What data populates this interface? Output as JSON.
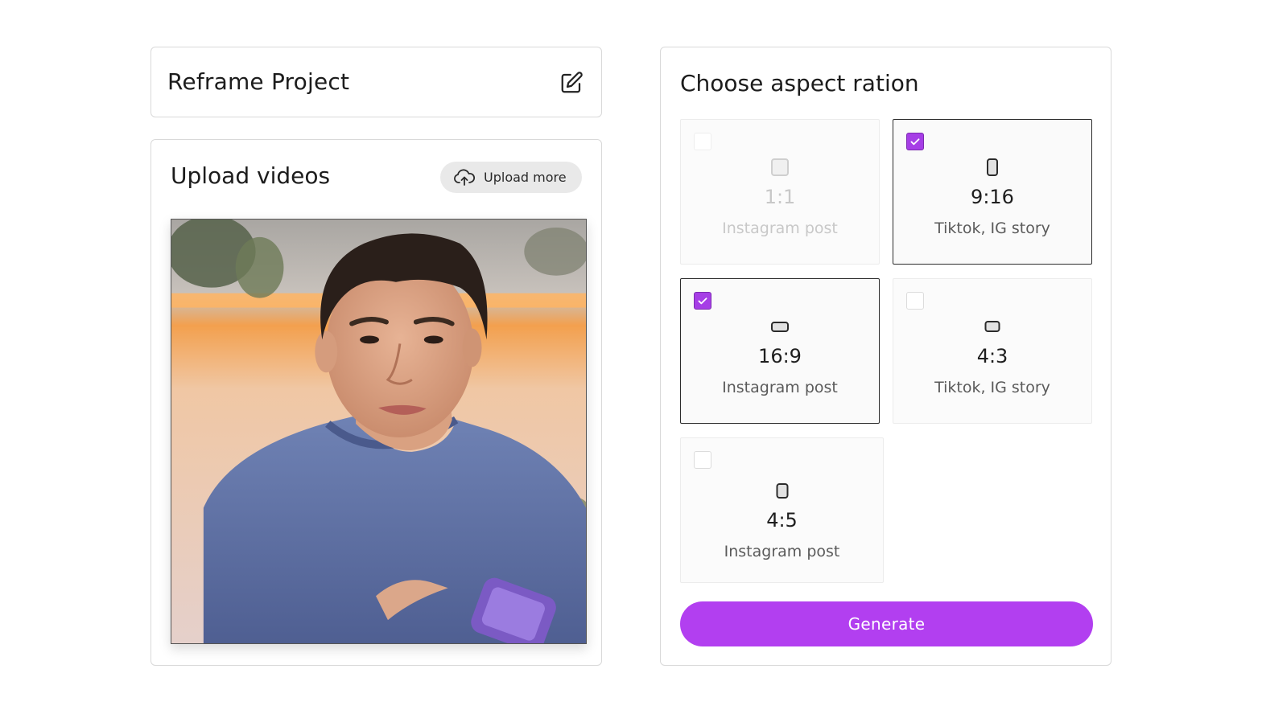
{
  "project": {
    "title": "Reframe Project",
    "edit_icon": "edit-icon"
  },
  "upload": {
    "title": "Upload videos",
    "upload_more_label": "Upload more",
    "upload_icon": "cloud-upload-icon"
  },
  "aspect": {
    "title": "Choose aspect ration",
    "options": [
      {
        "ratio": "1:1",
        "desc": "Instagram post",
        "checked": false,
        "disabled": true
      },
      {
        "ratio": "9:16",
        "desc": "Tiktok, IG story",
        "checked": true,
        "disabled": false
      },
      {
        "ratio": "16:9",
        "desc": "Instagram post",
        "checked": true,
        "disabled": false
      },
      {
        "ratio": "4:3",
        "desc": "Tiktok, IG story",
        "checked": false,
        "disabled": false
      },
      {
        "ratio": "4:5",
        "desc": "Instagram post",
        "checked": false,
        "disabled": false
      }
    ],
    "generate_label": "Generate"
  },
  "colors": {
    "accent": "#b23ff0",
    "checkbox": "#a63ee6",
    "border": "#d9d9d9"
  }
}
